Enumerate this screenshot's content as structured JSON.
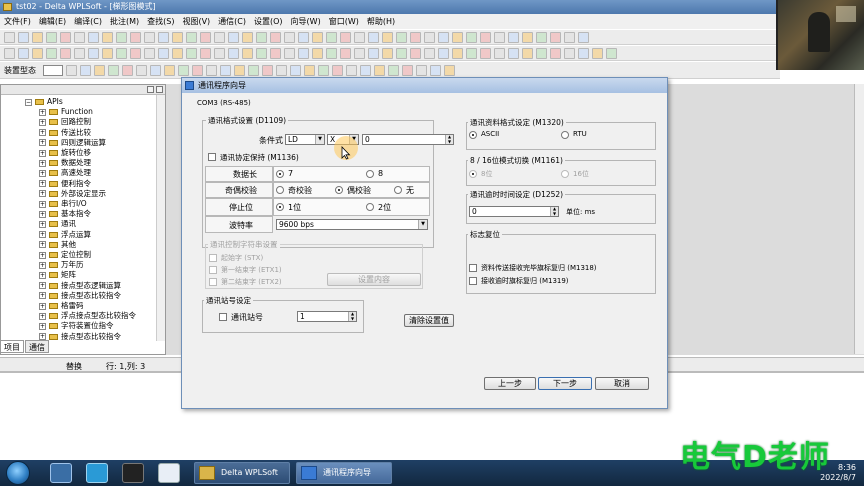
{
  "app": {
    "title": "tst02 - Delta WPLSoft - [梯形图模式]",
    "menu": [
      "文件(F)",
      "编辑(E)",
      "编译(C)",
      "批注(M)",
      "查找(S)",
      "视图(V)",
      "通信(C)",
      "设置(O)",
      "向导(W)",
      "窗口(W)",
      "帮助(H)"
    ],
    "device_state_label": "装置型态"
  },
  "tree": {
    "items": [
      {
        "label": "APIs",
        "pm": "−",
        "indent": 0
      },
      {
        "label": "Function",
        "pm": "+",
        "indent": 1
      },
      {
        "label": "回路控制",
        "pm": "+",
        "indent": 1
      },
      {
        "label": "传送比较",
        "pm": "+",
        "indent": 1
      },
      {
        "label": "四则逻辑运算",
        "pm": "+",
        "indent": 1
      },
      {
        "label": "旋转位移",
        "pm": "+",
        "indent": 1
      },
      {
        "label": "数据处理",
        "pm": "+",
        "indent": 1
      },
      {
        "label": "高速处理",
        "pm": "+",
        "indent": 1
      },
      {
        "label": "便利指令",
        "pm": "+",
        "indent": 1
      },
      {
        "label": "外部设定显示",
        "pm": "+",
        "indent": 1
      },
      {
        "label": "串行I/O",
        "pm": "+",
        "indent": 1
      },
      {
        "label": "基本指令",
        "pm": "+",
        "indent": 1
      },
      {
        "label": "通讯",
        "pm": "+",
        "indent": 1
      },
      {
        "label": "浮点运算",
        "pm": "+",
        "indent": 1
      },
      {
        "label": "其他",
        "pm": "+",
        "indent": 1
      },
      {
        "label": "定位控制",
        "pm": "+",
        "indent": 1
      },
      {
        "label": "万年历",
        "pm": "+",
        "indent": 1
      },
      {
        "label": "矩阵",
        "pm": "+",
        "indent": 1
      },
      {
        "label": "接点型态逻辑运算",
        "pm": "+",
        "indent": 1
      },
      {
        "label": "接点型态比较指令",
        "pm": "+",
        "indent": 1
      },
      {
        "label": "格雷码",
        "pm": "+",
        "indent": 1
      },
      {
        "label": "浮点接点型态比较指令",
        "pm": "+",
        "indent": 1
      },
      {
        "label": "字符装置位指令",
        "pm": "+",
        "indent": 1
      },
      {
        "label": "接点型态比较指令",
        "pm": "+",
        "indent": 1
      }
    ],
    "tabs": [
      "项目",
      "通信"
    ]
  },
  "status": {
    "mode": "替换",
    "position": "行: 1,列: 3"
  },
  "dialog": {
    "title": "通讯程序向导",
    "port": "COM3 (RS-485)",
    "format_group": "通讯格式设置 (D1109)",
    "condition_label": "条件式",
    "cond_op": "LD",
    "cond_dev": "X",
    "cond_value": "0",
    "protocol_hold": "通讯协定保持 (M1136)",
    "data_length_label": "数据长",
    "data_length_7": "7",
    "data_length_8": "8",
    "parity_label": "奇偶校验",
    "parity_odd": "奇校验",
    "parity_even": "偶校验",
    "parity_none": "无",
    "stopbit_label": "停止位",
    "stopbit_1": "1位",
    "stopbit_2": "2位",
    "baud_label": "波特率",
    "baud_value": "9600 bps",
    "ctrl_group": "通讯控制字符串设置",
    "start_char": "起始字 (STX)",
    "end_char_1": "第一结束字 (ETX1)",
    "end_char_2": "第二结束字 (ETX2)",
    "set_content": "设置内容",
    "station_group": "通讯站号设定",
    "station_label": "通讯站号",
    "station_value": "1",
    "clear_settings": "清除设置值",
    "data_format_group": "通讯资料格式设定 (M1320)",
    "ascii": "ASCII",
    "rtu": "RTU",
    "mode_group": "8 / 16位模式切换 (M1161)",
    "mode_8": "8位",
    "mode_16": "16位",
    "timeout_group": "通讯逾时时间设定 (D1252)",
    "timeout_value": "0",
    "timeout_unit": "单位: ms",
    "flag_group": "标志复位",
    "flag_recv": "资料传送接收完毕旗标复归 (M1318)",
    "flag_timeout": "接收逾时旗标复归 (M1319)",
    "prev": "上一步",
    "next": "下一步",
    "cancel": "取消"
  },
  "taskbar": {
    "app1": "Delta WPLSoft",
    "app2": "通讯程序向导",
    "time": "8:36",
    "date": "2022/8/7"
  },
  "watermark": "电气D老师"
}
